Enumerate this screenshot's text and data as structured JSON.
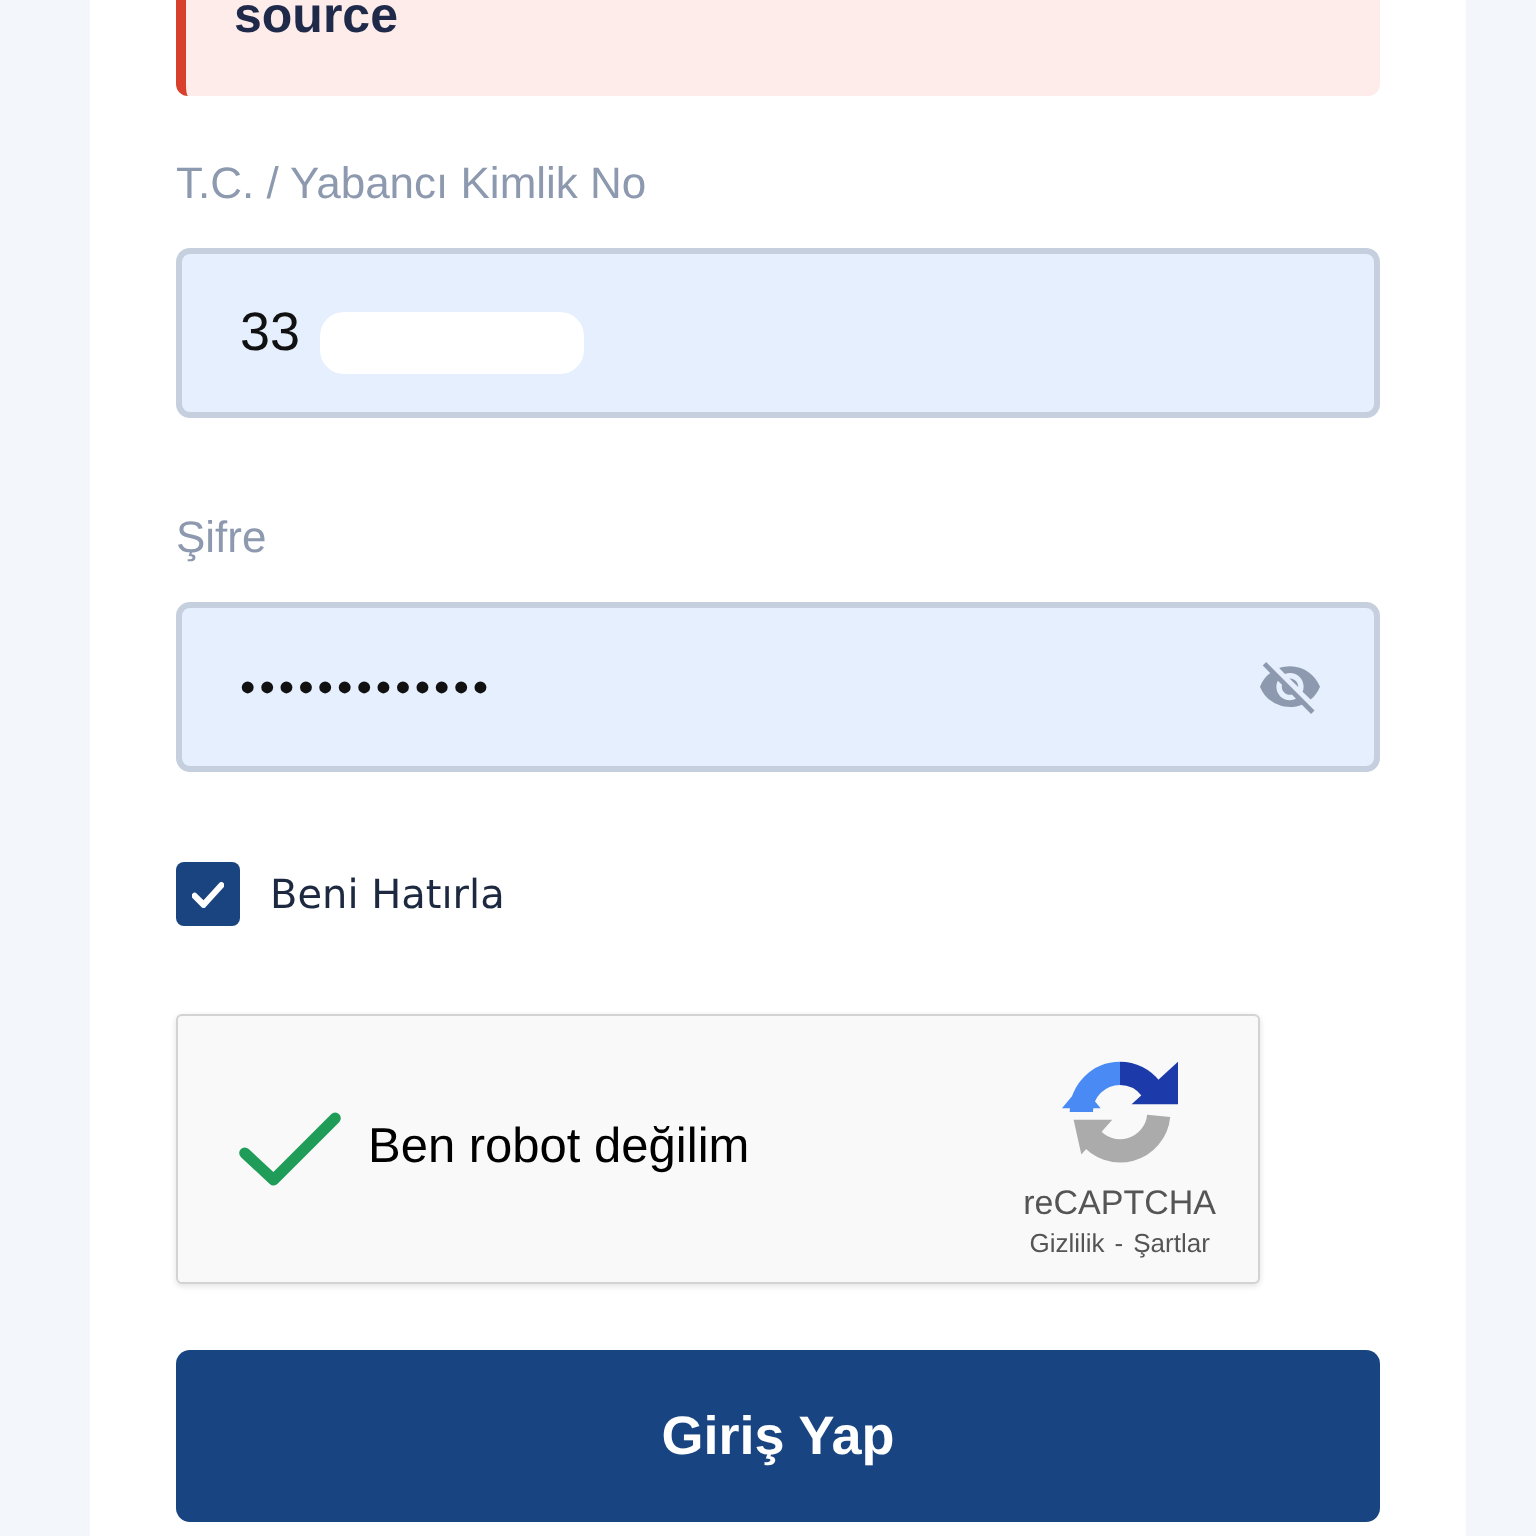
{
  "alert": {
    "text": "source"
  },
  "fields": [
    {
      "kind": "text",
      "label": "T.C. / Yabancı Kimlik No",
      "value": "33",
      "redacted": true
    },
    {
      "kind": "password",
      "label": "Şifre",
      "value": "•••••••••••••",
      "visible": false
    }
  ],
  "remember_me": {
    "label": "Beni Hatırla",
    "checked": true
  },
  "captcha": {
    "label": "Ben robot değilim",
    "checked": true,
    "brand": "reCAPTCHA",
    "privacy_link": "Gizlilik",
    "separator": "-",
    "terms_link": "Şartlar"
  },
  "submit_button": {
    "label": "Giriş Yap"
  }
}
